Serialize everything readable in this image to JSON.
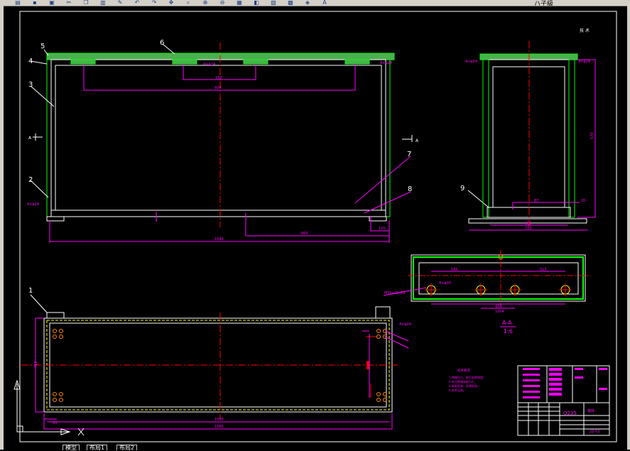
{
  "toolbar": {
    "icons": [
      "open-icon",
      "save-icon",
      "print-icon",
      "cut-icon",
      "copy-icon",
      "paste-icon",
      "match-icon",
      "undo-icon",
      "redo-icon",
      "pan-icon",
      "zoom-realtime-icon",
      "zoom-window-icon",
      "zoom-previous-icon",
      "properties-icon",
      "design-center-icon",
      "tool-palette-icon",
      "calculator-icon",
      "layer-icon",
      "text-style-icon"
    ],
    "text_tail": "ハ子級"
  },
  "tabs": [
    "模型",
    "布局1",
    "布局2"
  ],
  "drawing": {
    "title_note": "技  术",
    "part_labels": [
      "1",
      "2",
      "3",
      "4",
      "5",
      "6",
      "7",
      "8",
      "9"
    ],
    "section_marker": "A",
    "section_title": "A-A",
    "section_scale": "1:6",
    "material": "Q235",
    "drawing_no": "2Z-01",
    "part_name_small": "箱体",
    "notes_title": "技术要求",
    "notes": [
      "1.焊缝均匀，焊后去除焊渣；",
      "2.未注焊缝高度为5；",
      "3.表面喷漆，防锈处理；",
      "4.其余见图。"
    ],
    "dims": {
      "front_overall": "1540",
      "front_inner": "1470",
      "front_top_span": "920",
      "front_center": "150",
      "front_bottom_right": "660",
      "front_right_small": "120",
      "front_holes": "4×φ24",
      "side_height": "570",
      "side_width": "710",
      "side_inner": "650",
      "side_small": "87",
      "side_small2": "20",
      "plan_overall": "1580",
      "plan_inner": "1500",
      "plan_left": "20",
      "plan_height": "710",
      "section_left": "545",
      "section_right": "515",
      "section_mid": "434",
      "section_mid2": "1504",
      "section_hole": "4×φ30",
      "bolt_note": "M16×25-Z8"
    }
  },
  "colors": {
    "background": "#000000",
    "lines": "#ffffff",
    "dims": "#ff00ff",
    "center": "#ff0000",
    "weld": "#00ff00",
    "hidden": "#ffff00",
    "ucs": "#ffffff"
  }
}
